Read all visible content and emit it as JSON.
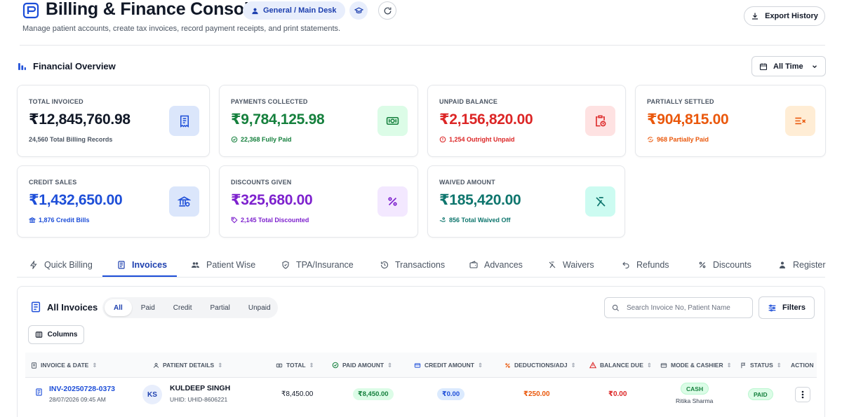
{
  "header": {
    "title": "Billing & Finance Console",
    "desk": "General / Main Desk",
    "subtitle": "Manage patient accounts, create tax invoices, record payment receipts, and print statements.",
    "export_label": "Export History"
  },
  "overview": {
    "title": "Financial Overview",
    "time_range": "All Time",
    "cards": [
      {
        "label": "TOTAL INVOICED",
        "value": "₹12,845,760.98",
        "sub": "24,560 Total Billing Records",
        "color": "#111827",
        "sub_color": "#4b5563",
        "icon": "receipt-icon"
      },
      {
        "label": "PAYMENTS COLLECTED",
        "value": "₹9,784,125.98",
        "sub": "22,368 Fully Paid",
        "color": "#15803d",
        "sub_color": "#15803d",
        "icon": "cash-icon"
      },
      {
        "label": "UNPAID BALANCE",
        "value": "₹2,156,820.00",
        "sub": "1,254 Outright Unpaid",
        "color": "#dc2626",
        "sub_color": "#dc2626",
        "icon": "clipboard-clock-icon"
      },
      {
        "label": "PARTIALLY SETTLED",
        "value": "₹904,815.00",
        "sub": "968 Partially Paid",
        "color": "#ea580c",
        "sub_color": "#ea580c",
        "icon": "partial-settle-icon"
      },
      {
        "label": "CREDIT SALES",
        "value": "₹1,432,650.00",
        "sub": "1,876 Credit Bills",
        "color": "#1d4ed8",
        "sub_color": "#1d4ed8",
        "icon": "bank-icon"
      },
      {
        "label": "DISCOUNTS GIVEN",
        "value": "₹325,680.00",
        "sub": "2,145 Total Discounted",
        "color": "#7e22ce",
        "sub_color": "#7e22ce",
        "icon": "percent-icon"
      },
      {
        "label": "WAIVED AMOUNT",
        "value": "₹185,420.00",
        "sub": "856 Total Waived Off",
        "color": "#0f766e",
        "sub_color": "#0f766e",
        "icon": "waive-icon"
      }
    ]
  },
  "tabs": [
    {
      "label": "Quick Billing",
      "icon": "bolt-icon"
    },
    {
      "label": "Invoices",
      "icon": "invoice-icon",
      "active": true
    },
    {
      "label": "Patient Wise",
      "icon": "users-icon"
    },
    {
      "label": "TPA/Insurance",
      "icon": "shield-icon"
    },
    {
      "label": "Transactions",
      "icon": "history-icon"
    },
    {
      "label": "Advances",
      "icon": "wallet-icon"
    },
    {
      "label": "Waivers",
      "icon": "waive-icon"
    },
    {
      "label": "Refunds",
      "icon": "undo-icon"
    },
    {
      "label": "Discounts",
      "icon": "percent-icon"
    },
    {
      "label": "Register",
      "icon": "register-icon"
    }
  ],
  "invoices": {
    "title": "All Invoices",
    "filters": [
      "All",
      "Paid",
      "Credit",
      "Partial",
      "Unpaid"
    ],
    "active_filter": "All",
    "search_placeholder": "Search Invoice No, Patient Name",
    "filters_label": "Filters",
    "columns_label": "Columns",
    "headers": [
      "INVOICE & DATE",
      "PATIENT DETAILS",
      "TOTAL",
      "PAID AMOUNT",
      "CREDIT AMOUNT",
      "DEDUCTIONS/ADJ",
      "BALANCE DUE",
      "MODE & CASHIER",
      "STATUS",
      "ACTION"
    ],
    "rows": [
      {
        "invoice_no": "INV-20250728-0373",
        "date": "28/07/2026 09:45 AM",
        "initials": "KS",
        "patient": "KULDEEP SINGH",
        "uhid": "UHID: UHID-8606221",
        "total": "₹8,450.00",
        "paid": "₹8,450.00",
        "credit": "₹0.00",
        "deductions": "₹250.00",
        "balance": "₹0.00",
        "mode": "CASH",
        "cashier": "Ritika Sharma",
        "status": "PAID"
      }
    ]
  }
}
